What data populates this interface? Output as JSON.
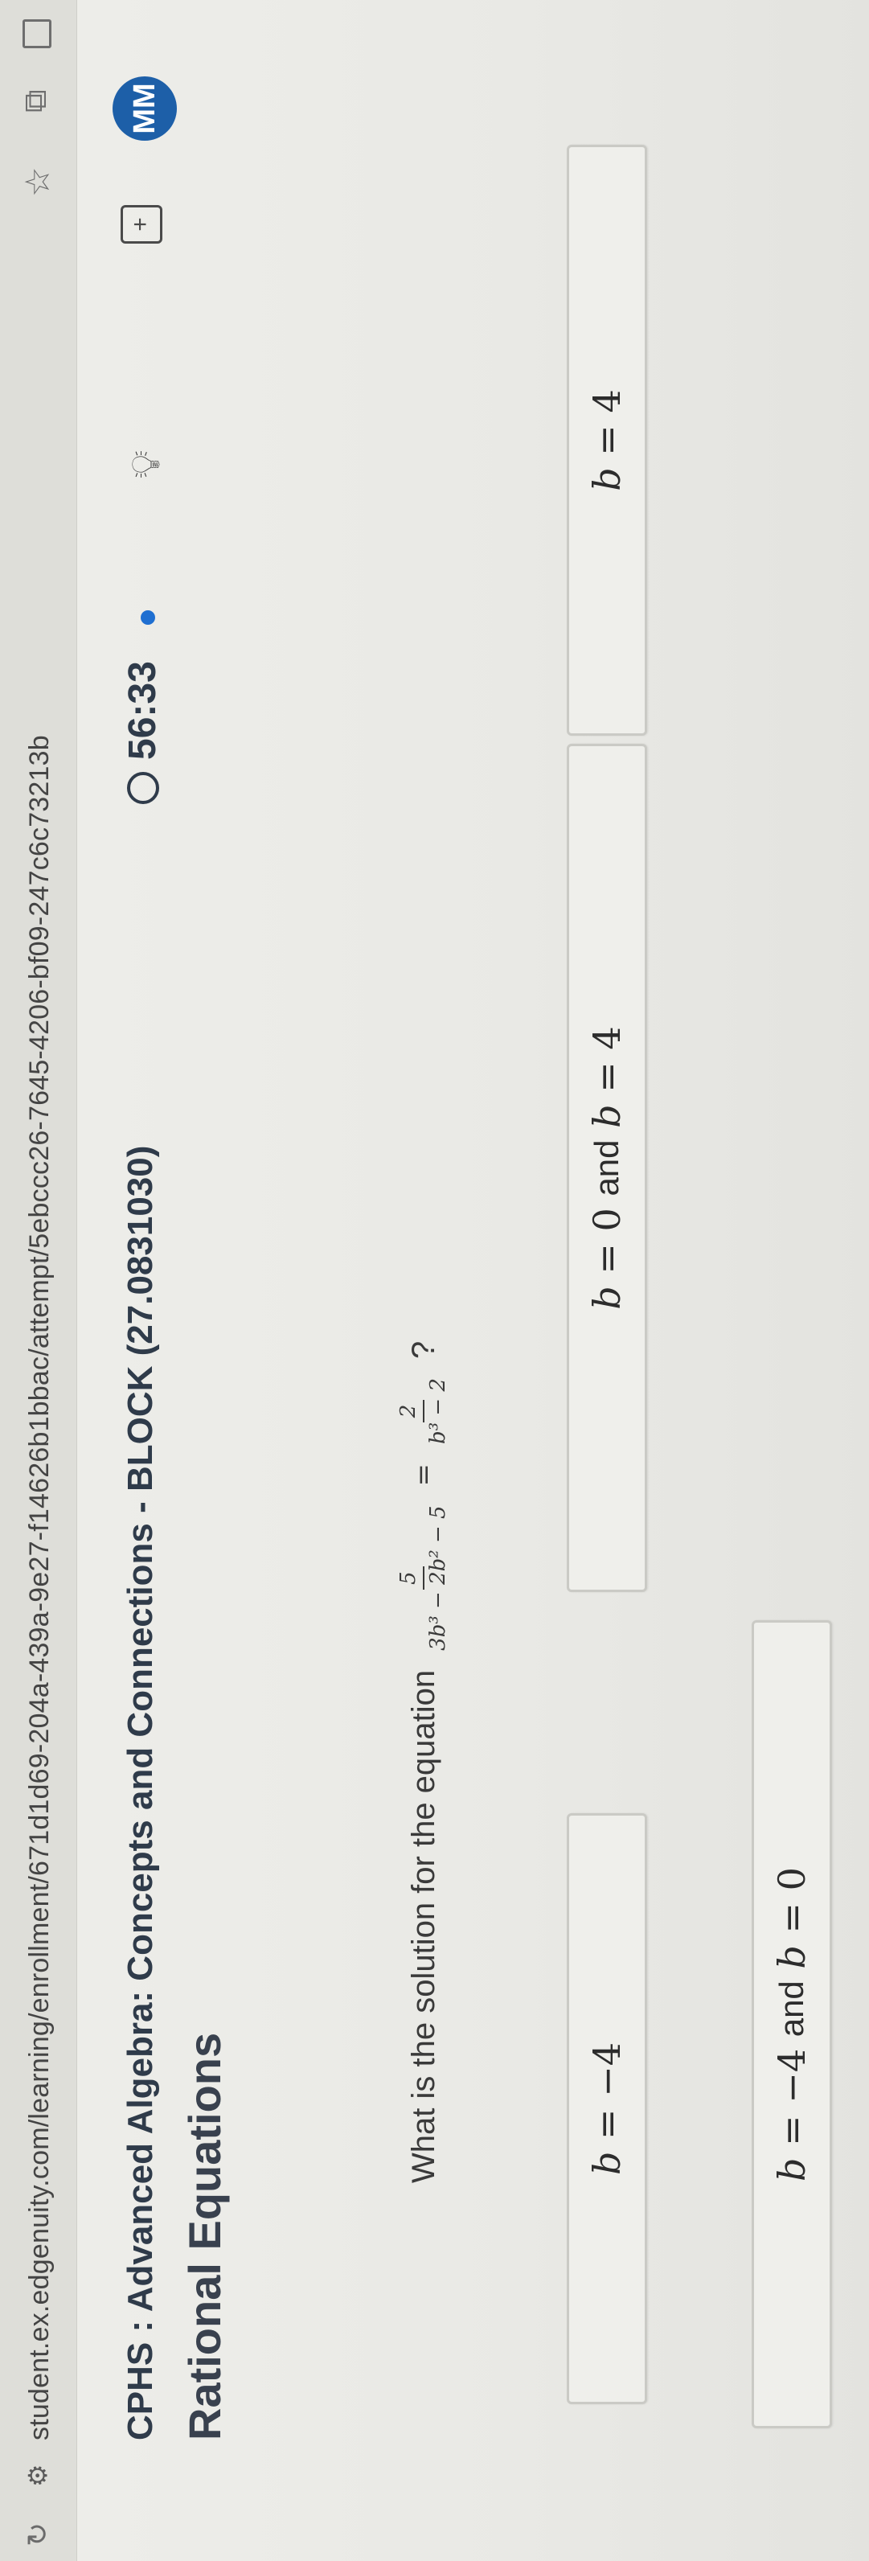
{
  "browser": {
    "url": "student.ex.edgenuity.com/learning/enrollment/671d1d69-204a-439a-9e27-f14626b1bbac/attempt/5ebccc26-7645-4206-bf09-247c6c73213b"
  },
  "header": {
    "course_title": "CPHS : Advanced Algebra: Concepts and Connections - BLOCK (27.0831030)",
    "lesson_title": "Rational Equations",
    "timer": "56:33",
    "avatar_initials": "MM"
  },
  "question": {
    "prompt": "What is the solution for the equation",
    "lhs_numerator": "5",
    "lhs_denominator": "3b³ − 2b² − 5",
    "rhs_numerator": "2",
    "rhs_denominator": "b³ − 2",
    "end_mark": "?"
  },
  "choices": [
    {
      "id": "a",
      "var": "b",
      "rel": " = −4"
    },
    {
      "id": "b",
      "var1": "b",
      "rel1": " = 0 ",
      "conj": "and",
      "var2": "b",
      "rel2": " = 4"
    },
    {
      "id": "c",
      "var": "b",
      "rel": " = 4"
    },
    {
      "id": "d",
      "var1": "b",
      "rel1": " = −4 ",
      "conj": "and",
      "var2": "b",
      "rel2": " = 0"
    }
  ],
  "colors": {
    "accent_blue": "#1f6fd1",
    "avatar_bg": "#1d5fa8",
    "header_text": "#2f3b4a"
  }
}
